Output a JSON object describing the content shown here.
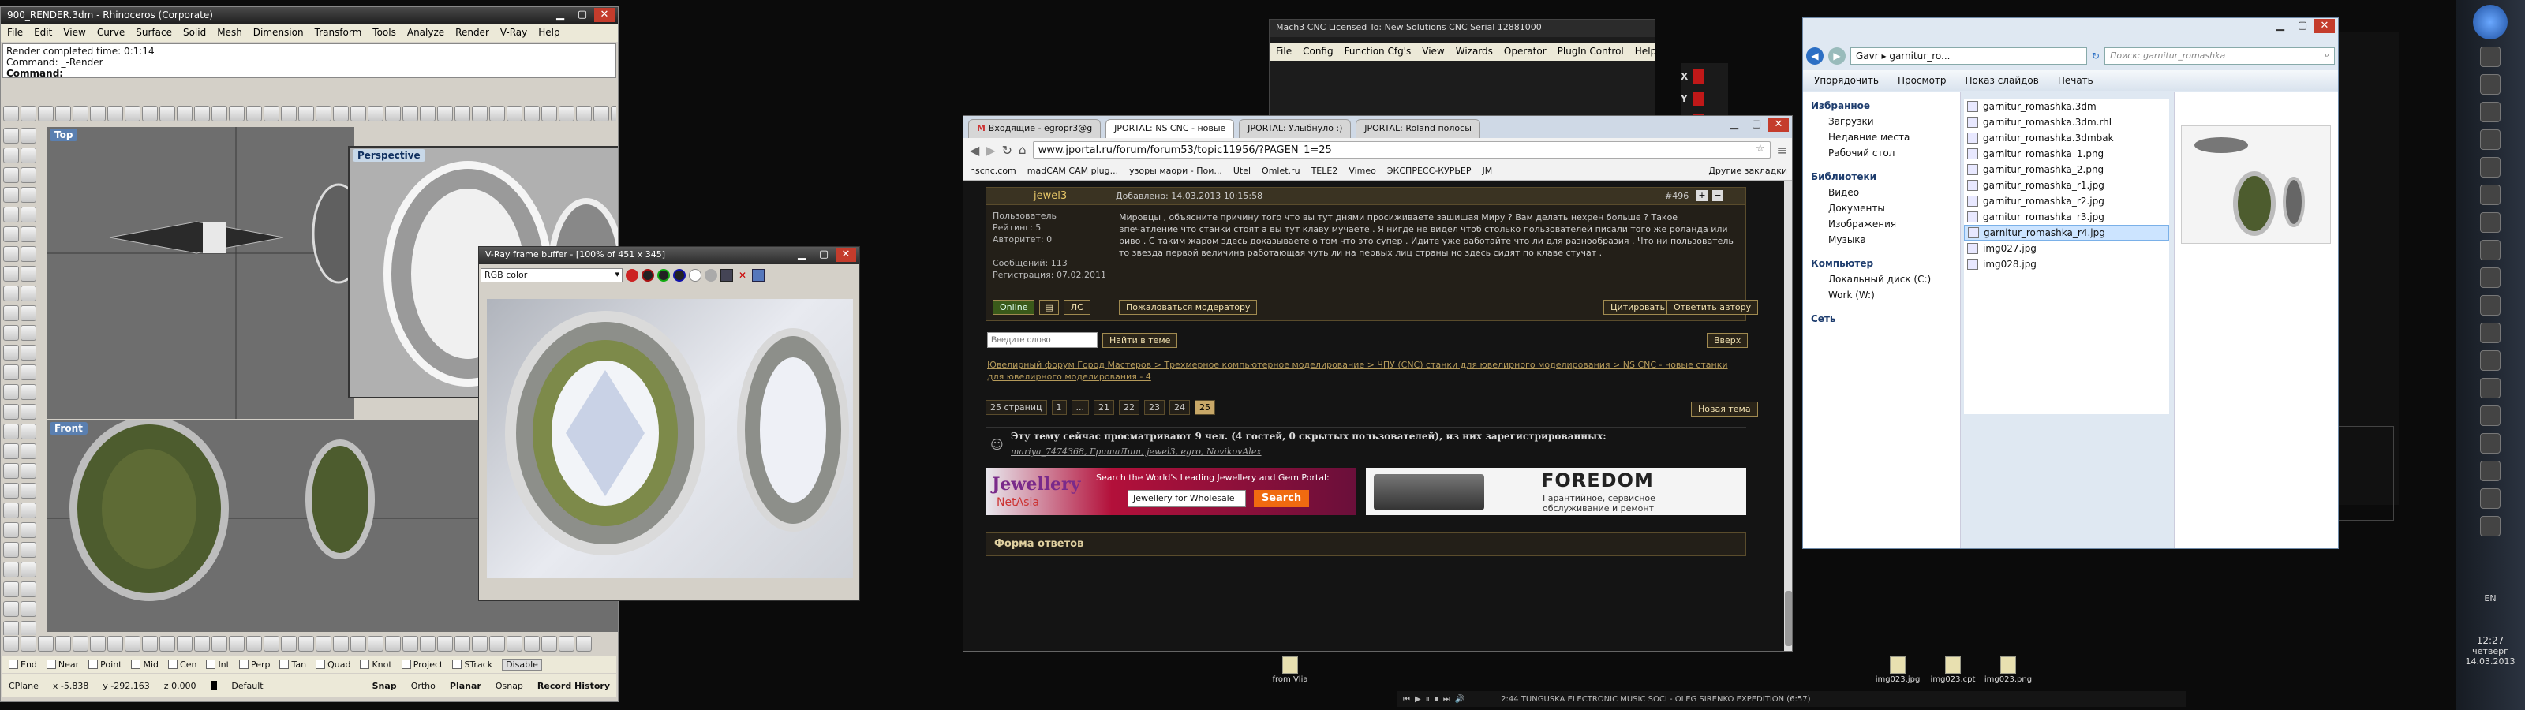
{
  "rhino": {
    "title": "900_RENDER.3dm - Rhinoceros (Corporate)",
    "menu": [
      "File",
      "Edit",
      "View",
      "Curve",
      "Surface",
      "Solid",
      "Mesh",
      "Dimension",
      "Transform",
      "Tools",
      "Analyze",
      "Render",
      "V-Ray",
      "Help"
    ],
    "history": [
      "Render completed time: 0:1:14",
      "Command: _-Render"
    ],
    "command_label": "Command:",
    "viewports": {
      "top": "Top",
      "perspective": "Perspective",
      "front": "Front"
    },
    "osnaps": [
      "End",
      "Near",
      "Point",
      "Mid",
      "Cen",
      "Int",
      "Perp",
      "Tan",
      "Quad",
      "Knot",
      "Project"
    ],
    "smarttrack": "STrack",
    "disable": "Disable",
    "status": {
      "cplane": "CPlane",
      "x": "x -5.838",
      "y": "y -292.163",
      "z": "z 0.000",
      "layer": "Default",
      "toggles": [
        "Snap",
        "Ortho",
        "Planar",
        "Osnap",
        "Record History"
      ]
    }
  },
  "vray": {
    "title": "V-Ray frame buffer - [100% of 451 x 345]",
    "channel": "RGB color"
  },
  "mach3": {
    "title": "Mach3 CNC  Licensed To: New Solutions CNC  Serial 12881000",
    "menu": [
      "File",
      "Config",
      "Function Cfg's",
      "View",
      "Wizards",
      "Operator",
      "PlugIn Control",
      "Help"
    ],
    "axes": [
      "X",
      "Y",
      "Z",
      "4"
    ]
  },
  "browser": {
    "tabs": [
      "Входящие - egropr3@g",
      "JPORTAL: NS CNC - новые",
      "JPORTAL: Улыбнуло :)",
      "JPORTAL: Roland полосы"
    ],
    "url": "www.jportal.ru/forum/forum53/topic11956/?PAGEN_1=25",
    "bookmarks": [
      "nscnc.com",
      "madCAM CAM plug...",
      "узоры маори - Пои...",
      "Utel",
      "Omlet.ru",
      "TELE2",
      "Vimeo",
      "ЭКСПРЕСС-КУРЬЕР",
      "JM"
    ],
    "bookmarks_more": "Другие закладки",
    "post": {
      "author": "jewel3",
      "date": "Добавлено: 14.03.2013 10:15:58",
      "number": "#496",
      "user_lines": [
        "Пользователь",
        "Рейтинг: 5",
        "Авторитет: 0",
        "",
        "Сообщений: 113",
        "Регистрация: 07.02.2011"
      ],
      "text": "Мировцы , объясните причину того что вы тут днями просиживаете зашишая Миру ? Вам делать нехрен больше ? Такое впечатление что станки стоят а вы тут клаву мучаете . Я нигде не видел чтоб столько пользователей писали того же роланда или риво . С таким жаром здесь доказываете о том что это супер . Идите уже работайте что ли для разнообразия . Что ни пользователь то звезда первой величина работающая чуть ли на первых лиц страны но здесь сидят по клаве стучат .",
      "online": "Online",
      "ls": "ЛС",
      "complain": "Пожаловаться модератору",
      "quote": "Цитировать",
      "reply": "Ответить автору"
    },
    "search_placeholder": "Введите слово",
    "search_button": "Найти в теме",
    "up_button": "Вверх",
    "breadcrumb": "Ювелирный форум Город Мастеров > Трехмерное компьютерное моделирование > ЧПУ (CNC) станки для ювелирного моделирования > NS CNC - новые станки для ювелирного моделирования - 4",
    "pages_label": "25 страниц",
    "pages": [
      "1",
      "...",
      "21",
      "22",
      "23",
      "24",
      "25"
    ],
    "new_topic": "Новая тема",
    "viewers_title": "Эту тему сейчас просматривают 9 чел. (4 гостей, 0 скрытых пользователей), из них зарегистрированных:",
    "viewers": "mariya_7474368, ГришаЛит, jewel3, egro, NovikovAlex",
    "banner1": {
      "brand": "Jewellery",
      "brand2": "NetAsia",
      "tagline": "Search the World's Leading Jewellery and Gem Portal:",
      "input": "Jewellery for Wholesale",
      "button": "Search"
    },
    "banner2": {
      "brand": "FOREDOM",
      "line1": "Гарантийное, сервисное",
      "line2": "обслуживание и ремонт"
    },
    "reply_form": "Форма ответов"
  },
  "explorer": {
    "path": "Gavr ▸ garnitur_ro...",
    "search_placeholder": "Поиск: garnitur_romashka",
    "toolbar": [
      "Упорядочить",
      "Просмотр",
      "Показ слайдов",
      "Печать"
    ],
    "nav": {
      "favorites": "Избранное",
      "fav_items": [
        "Загрузки",
        "Недавние места",
        "Рабочий стол"
      ],
      "libraries": "Библиотеки",
      "lib_items": [
        "Видео",
        "Документы",
        "Изображения",
        "Музыка"
      ],
      "computer": "Компьютер",
      "comp_items": [
        "Локальный диск (C:)",
        "Work (W:)"
      ],
      "network": "Сеть"
    },
    "files": [
      "garnitur_romashka.3dm",
      "garnitur_romashka.3dm.rhl",
      "garnitur_romashka.3dmbak",
      "garnitur_romashka_1.png",
      "garnitur_romashka_2.png",
      "garnitur_romashka_r1.jpg",
      "garnitur_romashka_r2.jpg",
      "garnitur_romashka_r3.jpg",
      "garnitur_romashka_r4.jpg",
      "img027.jpg",
      "img028.jpg"
    ],
    "selected_index": 8
  },
  "desktop": {
    "icons": [
      "from Vlia",
      "img023.jpg",
      "img023.cpt",
      "img023.png"
    ],
    "music": "2:44  TUNGUSKA ELECTRONIC MUSIC SOCI - OLEG SIRENKO EXPEDITION (6:57)"
  },
  "clock": {
    "lang": "EN",
    "time": "12:27",
    "day": "четверг",
    "date": "14.03.2013"
  }
}
